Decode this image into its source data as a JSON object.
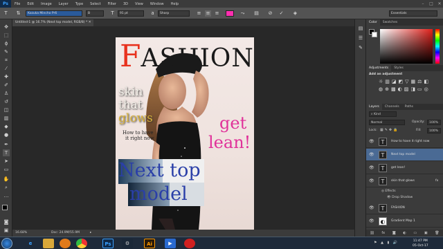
{
  "app": {
    "logo": "Ps"
  },
  "menu": [
    "File",
    "Edit",
    "Image",
    "Layer",
    "Type",
    "Select",
    "Filter",
    "3D",
    "View",
    "Window",
    "Help"
  ],
  "window_controls": [
    "–",
    "□",
    "✕"
  ],
  "options_bar": {
    "font_family": "Kozuka Mincho Pr6",
    "font_style": "B",
    "font_size": "91 pt",
    "antialias": "Sharp",
    "workspace": "Essentials"
  },
  "document": {
    "tab_title": "Untitled-1 @ 16.7% (Next top model, RGB/8) *"
  },
  "status": {
    "zoom": "16.68%",
    "doc_size": "Doc: 24.9M/55.9M"
  },
  "magazine": {
    "title_first": "F",
    "title_rest": "ASHION",
    "line1": "skin",
    "line2": "that",
    "line3": "glows",
    "sub1": "How to have",
    "sub2": "it right now",
    "get": "get",
    "lean": "lean!",
    "next": "Next top",
    "model": "model"
  },
  "colors": {
    "title_red": "#e8321e",
    "glows_yellow": "#d9b23a",
    "lean_pink": "#e0329a",
    "next_blue": "#2a3fa8",
    "accent": "#ff2fb0"
  },
  "color_panel": {
    "tabs": [
      "Color",
      "Swatches"
    ]
  },
  "adjustments": {
    "tabs": [
      "Adjustments",
      "Styles"
    ],
    "heading": "Add an adjustment"
  },
  "layers_panel": {
    "tabs": [
      "Layers",
      "Channels",
      "Paths"
    ],
    "kind": "Kind",
    "blend_mode": "Normal",
    "opacity_label": "Opacity:",
    "opacity": "100%",
    "lock_label": "Lock:",
    "fill_label": "Fill:",
    "fill": "100%",
    "layers": [
      {
        "name": "How to have  it right now",
        "type": "T",
        "selected": false
      },
      {
        "name": "Next top model",
        "type": "T",
        "selected": true
      },
      {
        "name": "get lean!",
        "type": "T",
        "selected": false
      },
      {
        "name": "skin  that  glows",
        "type": "T",
        "selected": false
      },
      {
        "name": "Effects",
        "type": "fx",
        "selected": false
      },
      {
        "name": "Drop Shadow",
        "type": "fx",
        "selected": false
      },
      {
        "name": "FASHION",
        "type": "T",
        "selected": false
      },
      {
        "name": "Gradient Map 1",
        "type": "adj",
        "selected": false
      }
    ]
  },
  "taskbar": {
    "time": "11:47 PM",
    "date": "05-Oct-17",
    "apps": [
      "IE",
      "Explorer",
      "Media",
      "Chrome",
      "Ps",
      "Steam",
      "Ai",
      "Video",
      "Record"
    ]
  }
}
